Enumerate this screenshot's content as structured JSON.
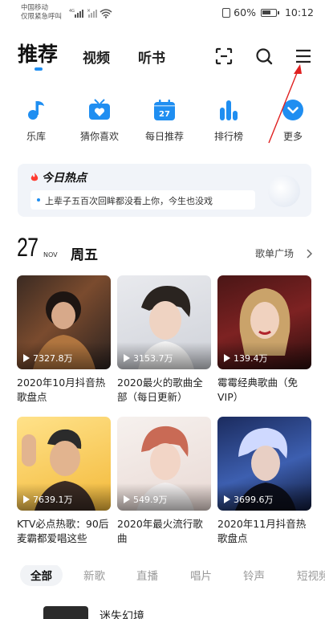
{
  "status_bar": {
    "carrier_line1": "中国移动",
    "carrier_line2": "仅限紧急呼叫",
    "battery": "60%",
    "time": "10:12"
  },
  "top_nav": {
    "tabs": [
      {
        "label": "推荐",
        "active": true
      },
      {
        "label": "视频",
        "active": false
      },
      {
        "label": "听书",
        "active": false
      }
    ],
    "icons": [
      "scan-icon",
      "search-icon",
      "menu-icon"
    ]
  },
  "entries": [
    {
      "label": "乐库",
      "icon": "music-note-icon"
    },
    {
      "label": "猜你喜欢",
      "icon": "heart-radio-icon"
    },
    {
      "label": "每日推荐",
      "icon": "calendar-icon",
      "icon_text": "27"
    },
    {
      "label": "排行榜",
      "icon": "ranking-bars-icon"
    },
    {
      "label": "更多",
      "icon": "chevron-down-circle-icon"
    }
  ],
  "hot": {
    "title": "今日热点",
    "item": "上辈子五百次回眸都没看上你，今生也没戏"
  },
  "date": {
    "day": "27",
    "month": "NOV",
    "weekday": "周五",
    "plaza_link": "歌单广场"
  },
  "playlists": [
    {
      "plays": "7327.8万",
      "title": "2020年10月抖音热歌盘点"
    },
    {
      "plays": "3153.7万",
      "title": "2020最火的歌曲全部（每日更新）"
    },
    {
      "plays": "139.4万",
      "title": "霉霉经典歌曲（免VIP）"
    },
    {
      "plays": "7639.1万",
      "title": "KTV必点热歌：90后麦霸都爱唱这些"
    },
    {
      "plays": "549.9万",
      "title": "2020年最火流行歌曲"
    },
    {
      "plays": "3699.6万",
      "title": "2020年11月抖音热歌盘点"
    }
  ],
  "bottom_tabs": [
    {
      "label": "全部",
      "active": true
    },
    {
      "label": "新歌",
      "active": false
    },
    {
      "label": "直播",
      "active": false
    },
    {
      "label": "唱片",
      "active": false
    },
    {
      "label": "铃声",
      "active": false
    },
    {
      "label": "短视频",
      "active": false
    }
  ],
  "next_section": {
    "title": "迷失幻境"
  },
  "colors": {
    "accent": "#1f8ef1",
    "annotation_arrow": "#e02020"
  }
}
